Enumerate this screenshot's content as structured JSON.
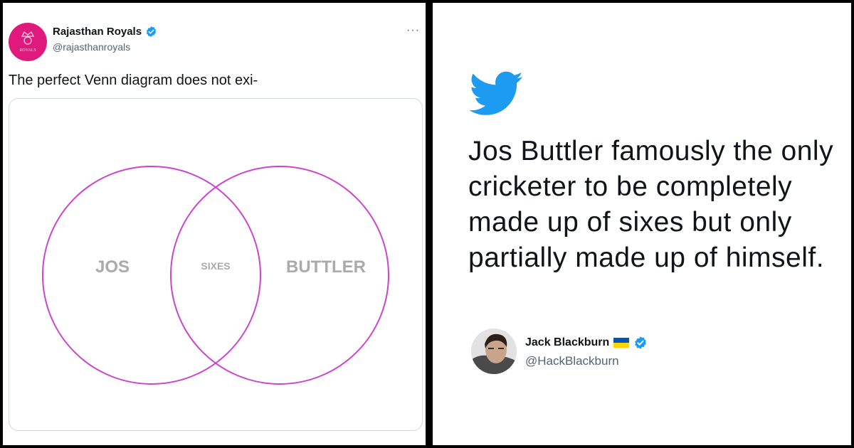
{
  "left_tweet": {
    "author_name": "Rajasthan Royals",
    "author_handle": "@rajasthanroyals",
    "avatar_text": "ROYALS",
    "more_label": "···",
    "text": "The perfect Venn diagram does not exi-",
    "venn": {
      "left_label": "JOS",
      "center_label": "SIXES",
      "right_label": "BUTTLER",
      "circle_color": "#cc44cc",
      "label_color": "#aaaaaa"
    }
  },
  "right_tweet": {
    "text": "Jos Buttler famously the only cricketer to be completely made up of sixes but only partially made up of himself.",
    "author_name": "Jack Blackburn",
    "author_handle": "@HackBlackburn",
    "flag": "ukraine-flag"
  },
  "colors": {
    "twitter_blue": "#1d9bf0",
    "verified_blue": "#1d9bf0",
    "rr_pink": "#e0197d"
  }
}
